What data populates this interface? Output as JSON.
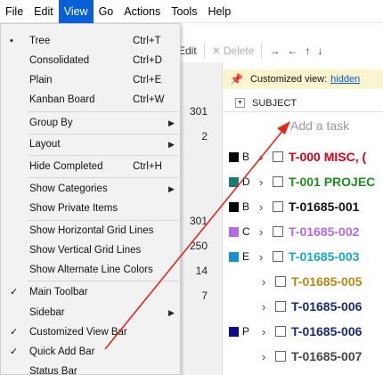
{
  "menubar": {
    "items": [
      "File",
      "Edit",
      "View",
      "Go",
      "Actions",
      "Tools",
      "Help"
    ]
  },
  "toolbar": {
    "edit_label": "Edit",
    "delete_label": "Delete"
  },
  "left_numbers": [
    "301",
    "2",
    "301",
    "250",
    "14",
    "7"
  ],
  "view_menu": {
    "items": [
      {
        "label": "Tree",
        "shortcut": "Ctrl+T",
        "mark": "•"
      },
      {
        "label": "Consolidated",
        "shortcut": "Ctrl+D"
      },
      {
        "label": "Plain",
        "shortcut": "Ctrl+E"
      },
      {
        "label": "Kanban Board",
        "shortcut": "Ctrl+W"
      },
      {
        "label": "Group By",
        "submenu": true
      },
      {
        "label": "Layout",
        "submenu": true
      },
      {
        "label": "Hide Completed",
        "shortcut": "Ctrl+H"
      },
      {
        "label": "Show Categories",
        "submenu": true
      },
      {
        "label": "Show Private Items"
      },
      {
        "label": "Show Horizontal Grid Lines"
      },
      {
        "label": "Show Vertical Grid Lines"
      },
      {
        "label": "Show Alternate Line Colors"
      },
      {
        "label": "Main Toolbar",
        "mark": "✓"
      },
      {
        "label": "Sidebar",
        "submenu": true
      },
      {
        "label": "Customized View Bar",
        "mark": "✓"
      },
      {
        "label": "Quick Add Bar",
        "mark": "✓"
      },
      {
        "label": "Status Bar"
      }
    ]
  },
  "customized_view": {
    "label": "Customized view:",
    "link": "hidden"
  },
  "subject_header": "SUBJECT",
  "add_task_placeholder": "Add a task",
  "tasks": [
    {
      "letter": "B",
      "swatch": "#000000",
      "title": "T-000 MISC, (",
      "color": "#d0021b"
    },
    {
      "letter": "D",
      "swatch": "#1a7a73",
      "title": "T-001 PROJEC",
      "color": "#1f8a1f"
    },
    {
      "letter": "B",
      "swatch": "#000000",
      "title": "T-01685-001",
      "color": "#111111"
    },
    {
      "letter": "C",
      "swatch": "#b36ae2",
      "title": "T-01685-002",
      "color": "#b36ae2"
    },
    {
      "letter": "E",
      "swatch": "#1a8fc9",
      "title": "T-01685-003",
      "color": "#19a7c9"
    },
    {
      "letter": "",
      "swatch": "",
      "title": "T-01685-005",
      "color": "#b38a1a"
    },
    {
      "letter": "",
      "swatch": "",
      "title": "T-01685-006",
      "color": "#1b2a6b"
    },
    {
      "letter": "P",
      "swatch": "#0a0a8a",
      "title": "T-01685-006",
      "color": "#1b2a6b"
    },
    {
      "letter": "",
      "swatch": "",
      "title": "T-01685-007",
      "color": "#444444"
    }
  ],
  "colors": {
    "menu_active": "#0a5fd6",
    "annotation_arrow": "#e0281e",
    "customized_bar": "#fbf5cf"
  }
}
